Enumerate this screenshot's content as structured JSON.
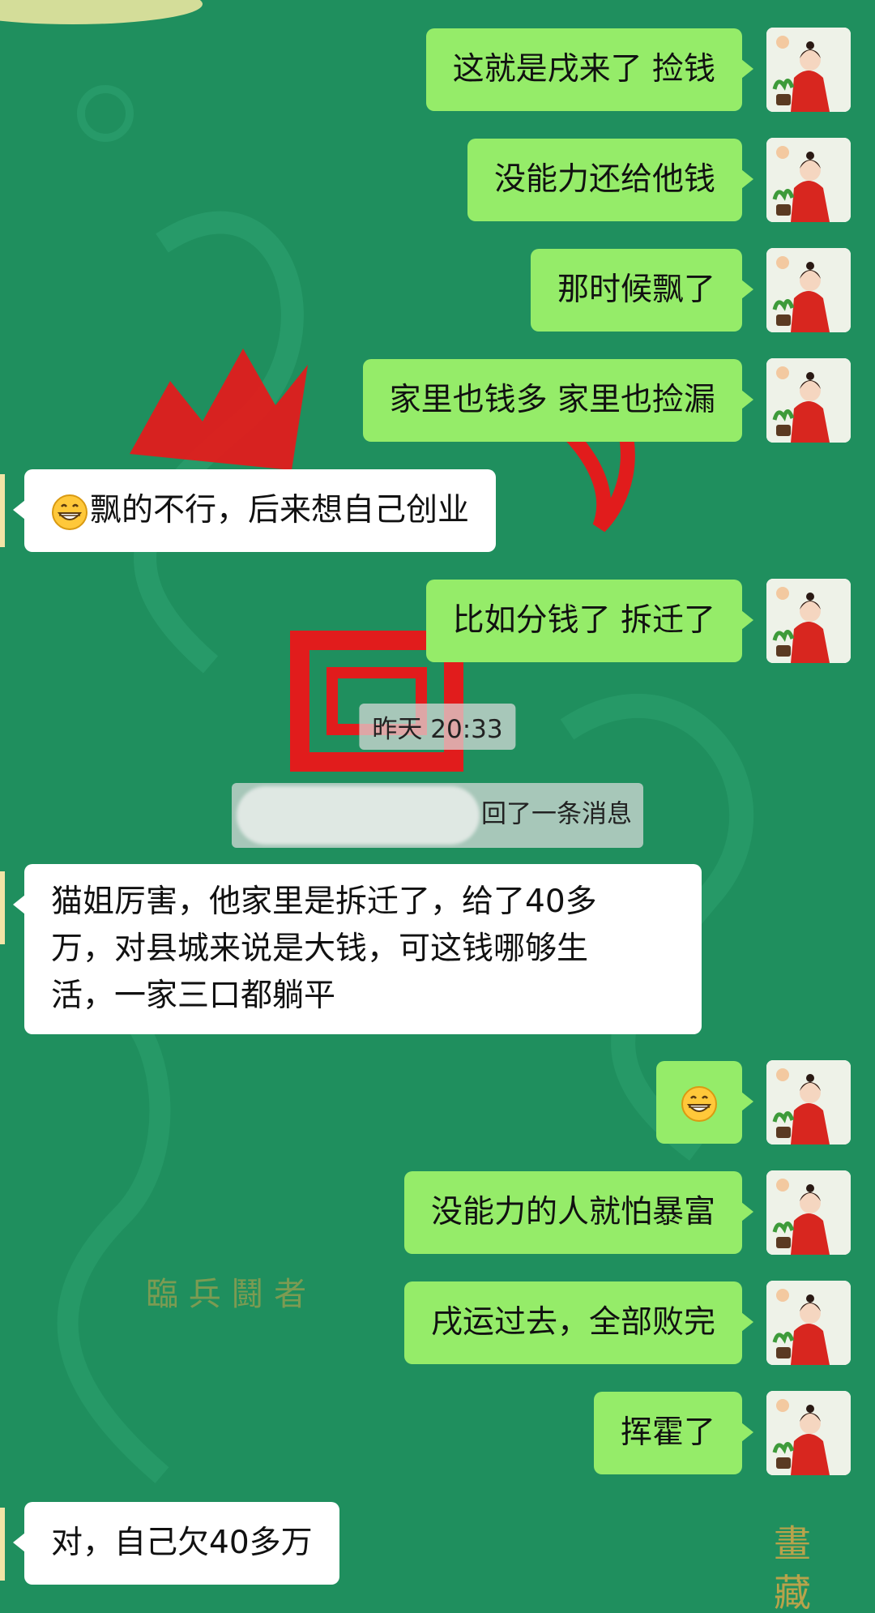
{
  "conversation": {
    "messages": [
      {
        "side": "out",
        "text": "这就是戌来了 捡钱"
      },
      {
        "side": "out",
        "text": "没能力还给他钱"
      },
      {
        "side": "out",
        "text": "那时候飘了"
      },
      {
        "side": "out",
        "text": "家里也钱多 家里也捡漏"
      },
      {
        "side": "in",
        "emoji": "grin",
        "text": "飘的不行，后来想自己创业"
      },
      {
        "side": "out",
        "text": "比如分钱了 拆迁了"
      },
      {
        "side": "in",
        "lines": [
          "猫姐厉害，他家里是拆迁了，给了40多",
          "万，对县城来说是大钱，可这钱哪够生",
          "活，一家三口都躺平"
        ]
      },
      {
        "side": "out",
        "emoji": "grin",
        "text": ""
      },
      {
        "side": "out",
        "text": "没能力的人就怕暴富"
      },
      {
        "side": "out",
        "text": "戌运过去，全部败完"
      },
      {
        "side": "out",
        "text": "挥霍了"
      },
      {
        "side": "in",
        "text": "对，自己欠40多万"
      }
    ],
    "timestamp": "昨天 20:33",
    "recall_notice": "回了一条消息"
  },
  "background": {
    "bottom_text": "臨 兵 鬪 者",
    "right_text": "畫 藏"
  },
  "colors": {
    "chat_bg": "#1f8f5e",
    "outgoing_bubble": "#95ec69",
    "incoming_bubble": "#ffffff"
  }
}
